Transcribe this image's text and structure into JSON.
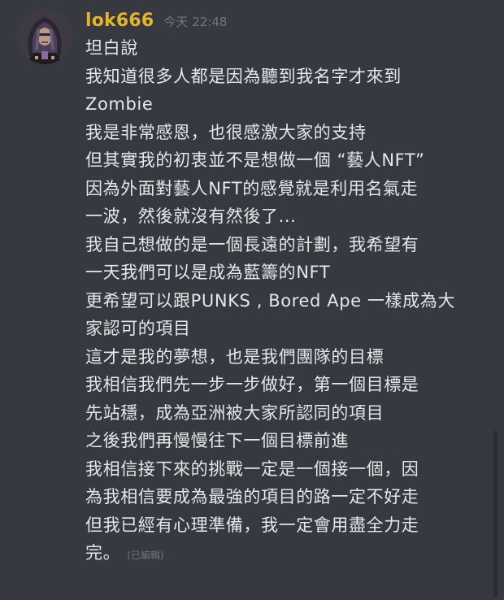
{
  "message": {
    "username": "lok666",
    "timestamp": "今天 22:48",
    "lines": [
      "坦白說",
      "我知道很多人都是因為聽到我名字才來到",
      "Zombie",
      "我是非常感恩，也很感激大家的支持",
      "但其實我的初衷並不是想做一個 “藝人NFT”",
      "因為外面對藝人NFT的感覺就是利用名氣走",
      "一波，然後就沒有然後了...",
      "我自己想做的是一個長遠的計劃，我希望有",
      "一天我們可以是成為藍籌的NFT",
      "更希望可以跟PUNKS , Bored Ape 一樣成為大",
      "家認可的項目",
      "這才是我的夢想，也是我們團隊的目標",
      "我相信我們先一步一步做好，第一個目標是",
      "先站穩，成為亞洲被大家所認同的項目",
      "之後我們再慢慢往下一個目標前進",
      "我相信接下來的挑戰一定是一個接一個，因",
      "為我相信要成為最強的項目的路一定不好走",
      "但我已經有心理準備，我一定會用盡全力走",
      "完。"
    ],
    "edited_label": "(已編輯)"
  },
  "colors": {
    "background": "#36393f",
    "username": "#e8b526",
    "text": "#e6e7e9",
    "muted": "#72767d"
  },
  "icons": {
    "avatar": "avatar-image"
  }
}
